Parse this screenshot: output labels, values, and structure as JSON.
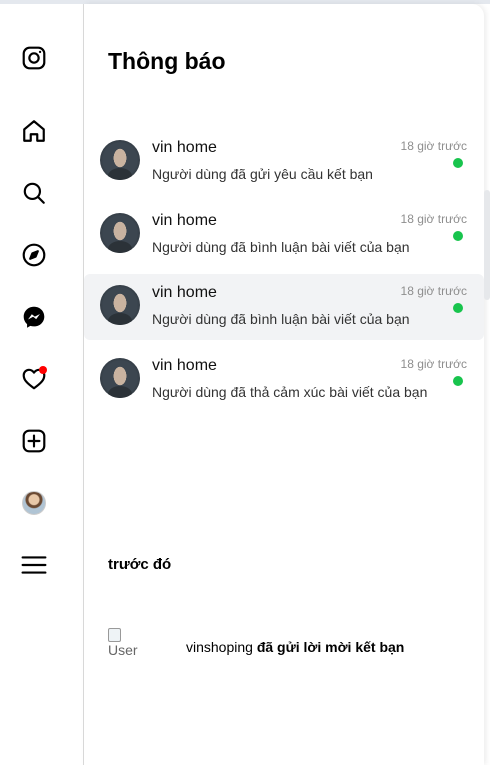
{
  "sidebar": {
    "items": [
      {
        "name": "instagram-logo"
      },
      {
        "name": "home"
      },
      {
        "name": "search"
      },
      {
        "name": "explore"
      },
      {
        "name": "messenger"
      },
      {
        "name": "notifications",
        "badge": true
      },
      {
        "name": "create"
      },
      {
        "name": "profile"
      },
      {
        "name": "menu"
      }
    ],
    "badge_color": "#ff0000"
  },
  "panel": {
    "title": "Thông báo",
    "notifications": [
      {
        "name": "vin home",
        "message": "Người dùng đã gửi yêu cầu kết bạn",
        "time": "18 giờ trước",
        "unread": true
      },
      {
        "name": "vin home",
        "message": "Người dùng đã bình luận bài viết của bạn",
        "time": "18 giờ trước",
        "unread": true
      },
      {
        "name": "vin home",
        "message": "Người dùng đã bình luận bài viết của bạn",
        "time": "18 giờ trước",
        "unread": true,
        "highlighted": true
      },
      {
        "name": "vin home",
        "message": "Người dùng đã thả cảm xúc bài viết của bạn",
        "time": "18 giờ trước",
        "unread": true
      }
    ],
    "unread_color": "#18c44d",
    "previous_section": {
      "title": "trước đó",
      "items": [
        {
          "image_alt": "User",
          "username": "vinshoping",
          "action": " đã gửi lời mời kết bạn"
        }
      ]
    }
  }
}
